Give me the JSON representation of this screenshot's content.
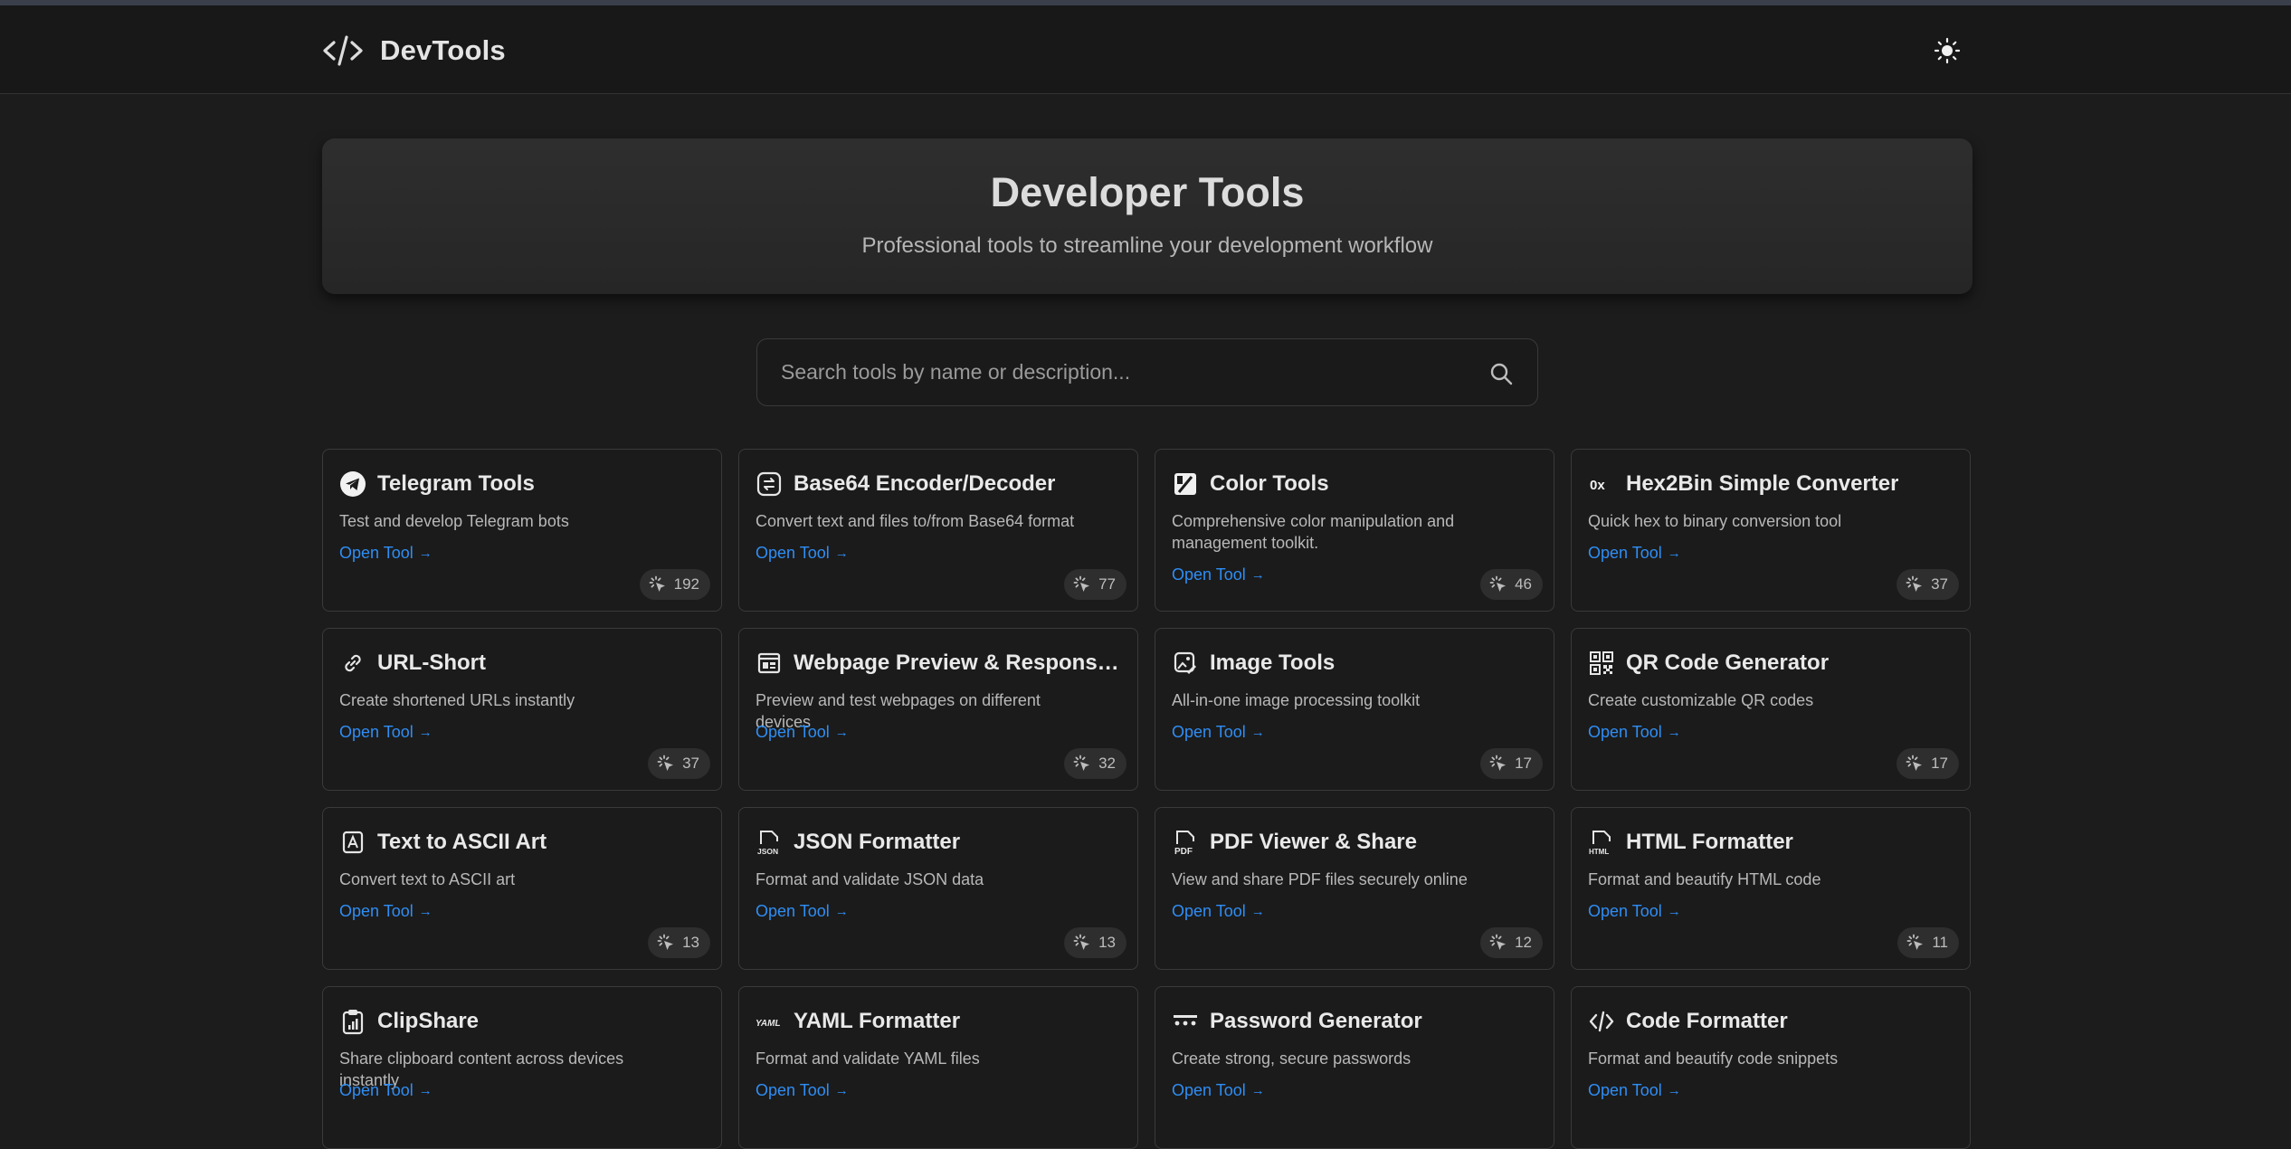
{
  "brand": {
    "name": "DevTools",
    "icon": "code-icon"
  },
  "header": {
    "theme_toggle_icon": "sun-icon"
  },
  "hero": {
    "title": "Developer Tools",
    "subtitle": "Professional tools to streamline your development workflow"
  },
  "search": {
    "placeholder": "Search tools by name or description...",
    "value": ""
  },
  "colors": {
    "background": "#1c1c1c",
    "accent": "#2f8ef5",
    "card_border": "#3a3a3a"
  },
  "tools": [
    {
      "title": "Telegram Tools",
      "icon": "telegram-icon",
      "description": "Test and develop Telegram bots",
      "link": "Open Tool",
      "count": "192"
    },
    {
      "title": "Base64 Encoder/Decoder",
      "icon": "base64-icon",
      "description": "Convert text and files to/from Base64 format",
      "link": "Open Tool",
      "count": "77"
    },
    {
      "title": "Color Tools",
      "icon": "palette-icon",
      "description": "Comprehensive color manipulation and management toolkit.",
      "link": "Open Tool",
      "count": "46"
    },
    {
      "title": "Hex2Bin Simple Converter",
      "icon": "hex-icon",
      "icon_text": "0x",
      "description": "Quick hex to binary conversion tool",
      "link": "Open Tool",
      "count": "37"
    },
    {
      "title": "URL-Short",
      "icon": "link-icon",
      "description": "Create shortened URLs instantly",
      "link": "Open Tool",
      "count": "37"
    },
    {
      "title": "Webpage Preview & Responsive Tester",
      "icon": "webpage-icon",
      "description": "Preview and test webpages on different devices",
      "link": "Open Tool",
      "count": "32"
    },
    {
      "title": "Image Tools",
      "icon": "image-edit-icon",
      "description": "All-in-one image processing toolkit",
      "link": "Open Tool",
      "count": "17"
    },
    {
      "title": "QR Code Generator",
      "icon": "qr-code-icon",
      "description": "Create customizable QR codes",
      "link": "Open Tool",
      "count": "17"
    },
    {
      "title": "Text to ASCII Art",
      "icon": "ascii-art-icon",
      "description": "Convert text to ASCII art",
      "link": "Open Tool",
      "count": "13"
    },
    {
      "title": "JSON Formatter",
      "icon": "json-file-icon",
      "icon_text": "JSON",
      "description": "Format and validate JSON data",
      "link": "Open Tool",
      "count": "13"
    },
    {
      "title": "PDF Viewer & Share",
      "icon": "pdf-file-icon",
      "icon_text": "PDF",
      "description": "View and share PDF files securely online",
      "link": "Open Tool",
      "count": "12"
    },
    {
      "title": "HTML Formatter",
      "icon": "html-file-icon",
      "icon_text": "HTML",
      "description": "Format and beautify HTML code",
      "link": "Open Tool",
      "count": "11"
    },
    {
      "title": "ClipShare",
      "icon": "clipboard-chart-icon",
      "description": "Share clipboard content across devices instantly",
      "link": "Open Tool",
      "count": ""
    },
    {
      "title": "YAML Formatter",
      "icon": "yaml-icon",
      "icon_text": "YAML",
      "description": "Format and validate YAML files",
      "link": "Open Tool",
      "count": ""
    },
    {
      "title": "Password Generator",
      "icon": "password-icon",
      "icon_text": "***",
      "description": "Create strong, secure passwords",
      "link": "Open Tool",
      "count": ""
    },
    {
      "title": "Code Formatter",
      "icon": "code-icon",
      "description": "Format and beautify code snippets",
      "link": "Open Tool",
      "count": ""
    }
  ]
}
